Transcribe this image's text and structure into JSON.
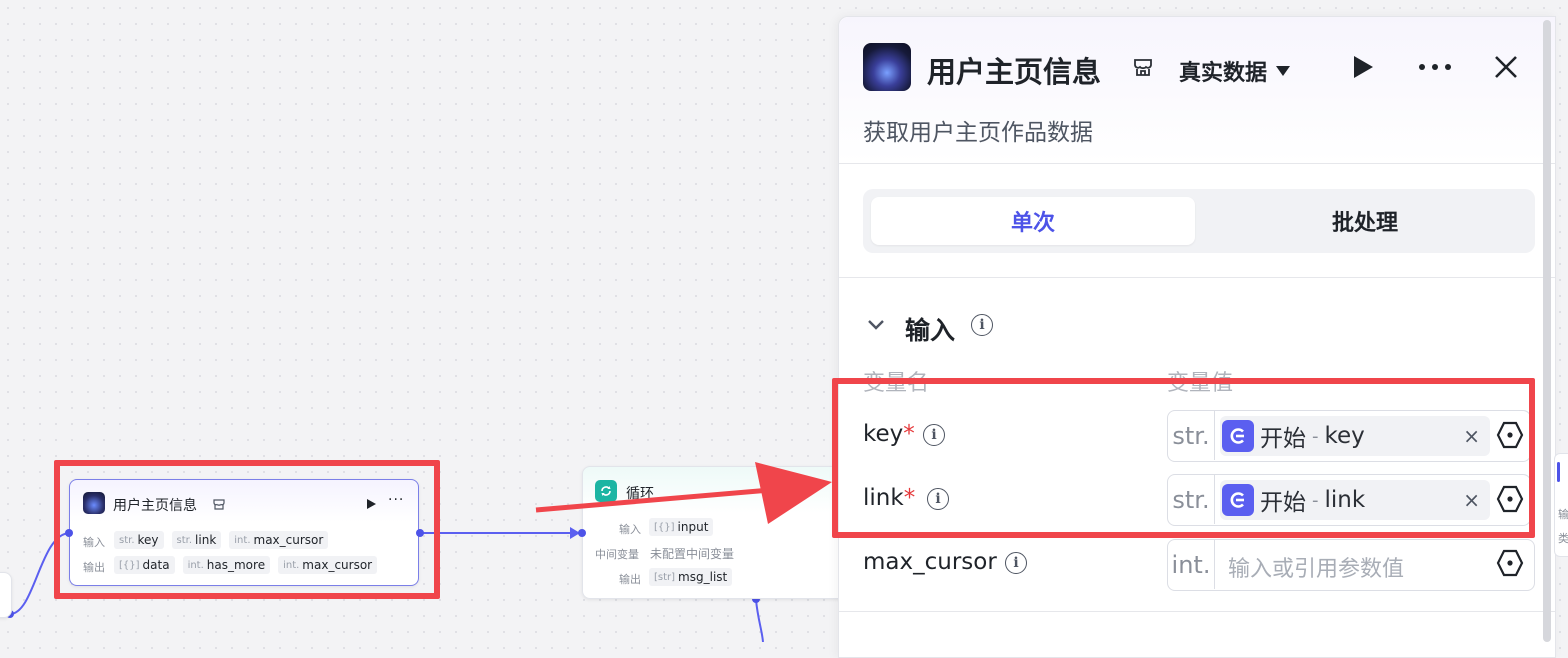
{
  "canvas": {
    "plugin_node": {
      "title": "用户主页信息",
      "input_label": "输入",
      "output_label": "输出",
      "inputs": [
        {
          "type": "str.",
          "name": "key"
        },
        {
          "type": "str.",
          "name": "link"
        },
        {
          "type": "int.",
          "name": "max_cursor"
        }
      ],
      "outputs": [
        {
          "type": "[{}]",
          "name": "data"
        },
        {
          "type": "int.",
          "name": "has_more"
        },
        {
          "type": "int.",
          "name": "max_cursor"
        }
      ]
    },
    "loop_node": {
      "title": "循环",
      "input_label": "输入",
      "input_type": "[{}]",
      "input_name": "input",
      "mid_label": "中间变量",
      "mid_value": "未配置中间变量",
      "output_label": "输出",
      "output_type": "[str]",
      "output_name": "msg_list"
    },
    "edge_node_text": {
      "a": "输",
      "b": "类"
    }
  },
  "panel": {
    "title": "用户主页信息",
    "data_mode": "真实数据",
    "description": "获取用户主页作品数据",
    "tabs": [
      "单次",
      "批处理"
    ],
    "active_tab": 0,
    "section_title": "输入",
    "col_name": "变量名",
    "col_value": "变量值",
    "params": [
      {
        "name": "key",
        "required": true,
        "type": "str.",
        "ref_source": "开始",
        "ref_sep": "-",
        "ref_var": "key"
      },
      {
        "name": "link",
        "required": true,
        "type": "str.",
        "ref_source": "开始",
        "ref_sep": "-",
        "ref_var": "link"
      },
      {
        "name": "max_cursor",
        "required": false,
        "type": "int.",
        "placeholder": "输入或引用参数值"
      }
    ],
    "required_mark": "*",
    "clear_glyph": "×"
  },
  "colors": {
    "accent": "#4d53e8",
    "highlight_red": "#f0454b",
    "loop_teal": "#1cb5a3"
  }
}
